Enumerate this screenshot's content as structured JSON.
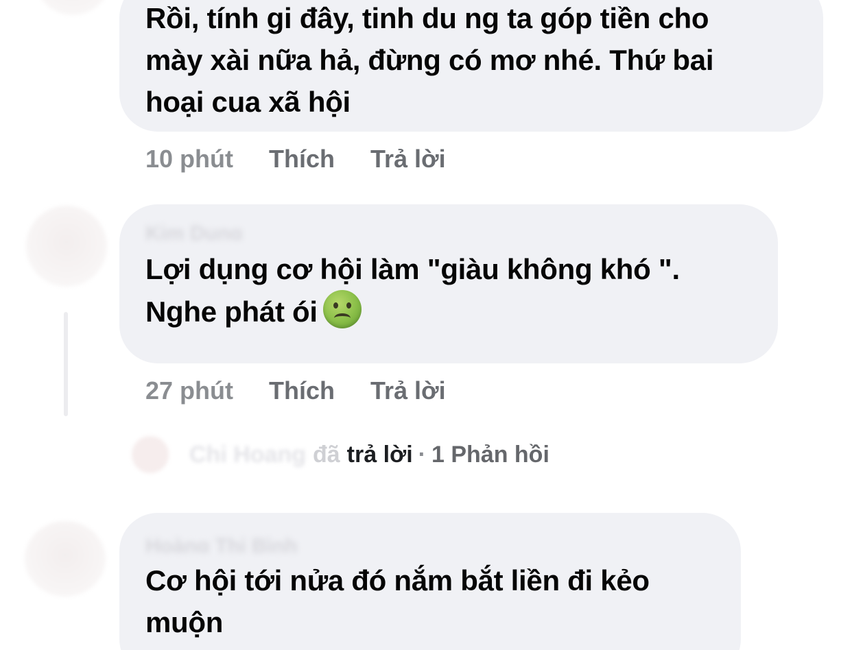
{
  "comments": [
    {
      "text_lines": [
        "Rồi, tính gi đây, tinh du ng ta góp tiền cho",
        "mày xài nữa hả, đừng có mơ nhé. Thứ bai",
        "hoại cua xã hội"
      ],
      "time": "10 phút",
      "like_label": "Thích",
      "reply_label": "Trả lời"
    },
    {
      "author": "Kim Dung",
      "text_lines": [
        "Lợi dụng cơ hội làm \"giàu không khó \".",
        "Nghe phát ói"
      ],
      "emoji": "nauseated-face-icon",
      "time": "27 phút",
      "like_label": "Thích",
      "reply_label": "Trả lời",
      "reply_summary": {
        "name": "Chi Hoang",
        "verb_part1": "đã",
        "verb_part2": "trả lời",
        "separator": "·",
        "count_label": "1 Phản hồi"
      }
    },
    {
      "author": "Hoàng Thị Bình",
      "text_lines": [
        "Cơ hội tới nửa đó nắm bắt liền đi kẻo",
        "muộn"
      ]
    }
  ],
  "colors": {
    "bubble": "#f0f1f5",
    "text": "#050505",
    "meta_time": "#8a8d91",
    "meta_action": "#6a6d72",
    "emoji_green": "#8cc04a"
  }
}
